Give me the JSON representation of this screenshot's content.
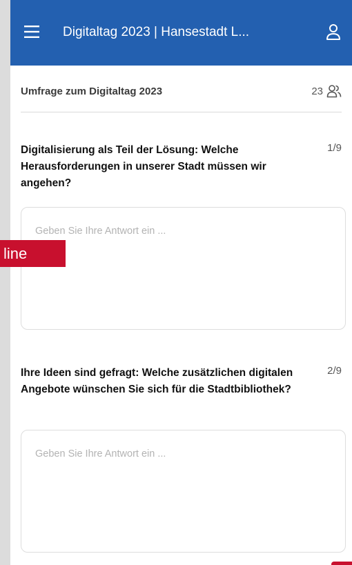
{
  "header": {
    "title": "Digitaltag 2023 | Hansestadt L...",
    "menu_icon": "hamburger-menu-icon",
    "user_icon": "user-icon",
    "color": "#2360b0"
  },
  "survey": {
    "title": "Umfrage zum Digitaltag 2023",
    "participant_count": "23",
    "participant_icon": "users-icon"
  },
  "questions": [
    {
      "text": "Digitalisierung als Teil der Lösung: Welche Herausforderungen in unserer Stadt müssen wir angehen?",
      "index": "1/9",
      "placeholder": "Geben Sie Ihre Antwort ein ..."
    },
    {
      "text": "Ihre Ideen sind gefragt: Welche zusätzlichen digitalen Angebote wünschen Sie sich für die Stadtbibliothek?",
      "index": "2/9",
      "placeholder": "Geben Sie Ihre Antwort ein ..."
    }
  ],
  "overlay": {
    "badge_text": "line",
    "color": "#c8102e"
  }
}
